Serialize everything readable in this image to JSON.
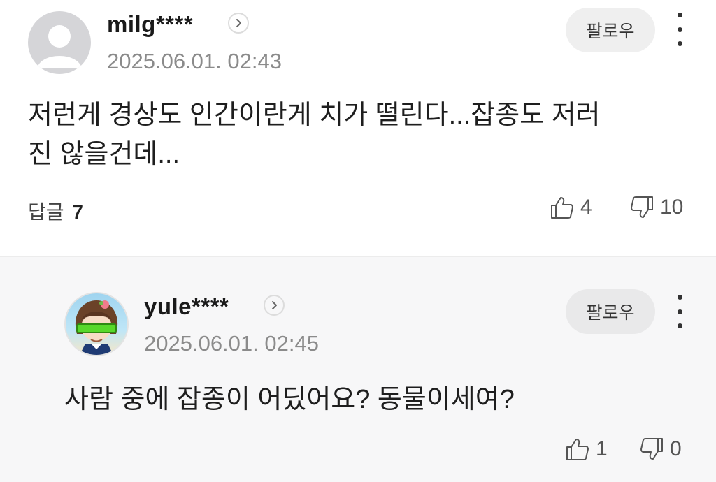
{
  "comments": [
    {
      "username": "milg****",
      "timestamp": "2025.06.01. 02:43",
      "follow_label": "팔로우",
      "text_line1": "저런게 경상도 인간이란게 치가 떨린다...잡종도 저러",
      "text_line2": "진 않을건데...",
      "reply_label": "답글",
      "reply_count": "7",
      "likes": "4",
      "dislikes": "10"
    },
    {
      "username": "yule****",
      "timestamp": "2025.06.01. 02:45",
      "follow_label": "팔로우",
      "text_line1": "사람 중에 잡종이 어딨어요? 동물이세여?",
      "likes": "1",
      "dislikes": "0"
    }
  ],
  "colors": {
    "background": "#ffffff",
    "reply_background": "#f7f7f8",
    "follow_button": "#efefef",
    "timestamp": "#8b8b8b"
  },
  "icons": {
    "default_avatar": "person-silhouette-icon",
    "profile_chevron": "chevron-right-icon",
    "more": "vertical-ellipsis-icon",
    "like": "thumbs-up-icon",
    "dislike": "thumbs-down-icon"
  }
}
